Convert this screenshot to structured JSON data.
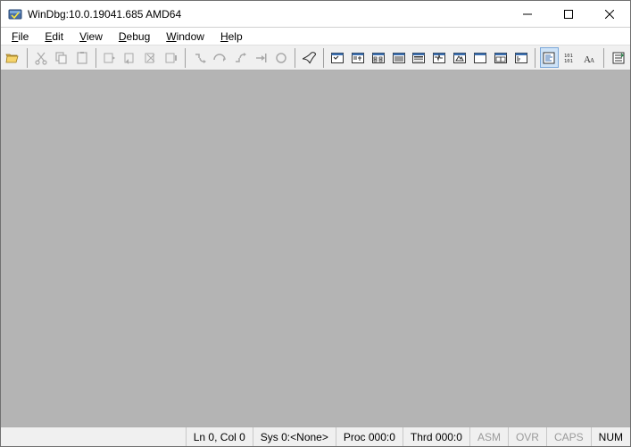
{
  "title": "WinDbg:10.0.19041.685 AMD64",
  "menubar": {
    "file": "File",
    "edit": "Edit",
    "view": "View",
    "debug": "Debug",
    "window": "Window",
    "help": "Help"
  },
  "toolbar": {
    "open_icon": "open-file-icon",
    "cut_icon": "cut-icon",
    "copy_icon": "copy-icon",
    "paste_icon": "paste-icon",
    "go_icon": "go-icon",
    "restart_icon": "restart-icon",
    "stop_icon": "stop-icon",
    "break_icon": "break-icon",
    "step_into_icon": "step-into-icon",
    "step_over_icon": "step-over-icon",
    "step_out_icon": "step-out-icon",
    "run_to_cursor_icon": "run-to-cursor-icon",
    "toggle_bp_icon": "toggle-breakpoint-icon",
    "command_icon": "command-window-icon",
    "watch_icon": "watch-window-icon",
    "locals_icon": "locals-window-icon",
    "registers_icon": "registers-window-icon",
    "memory_icon": "memory-window-icon",
    "callstack_icon": "call-stack-window-icon",
    "disasm_icon": "disassembly-window-icon",
    "scratch_icon": "scratch-pad-icon",
    "procthread_icon": "processes-threads-window-icon",
    "cmdbrowser_icon": "command-browser-icon",
    "srcmode_icon": "source-mode-icon",
    "binary_icon": "binary-icon",
    "font_icon": "font-icon",
    "options_icon": "options-icon"
  },
  "status": {
    "line_col": "Ln 0, Col 0",
    "sys": "Sys 0:<None>",
    "proc": "Proc 000:0",
    "thrd": "Thrd 000:0",
    "asm": "ASM",
    "ovr": "OVR",
    "caps": "CAPS",
    "num": "NUM"
  }
}
